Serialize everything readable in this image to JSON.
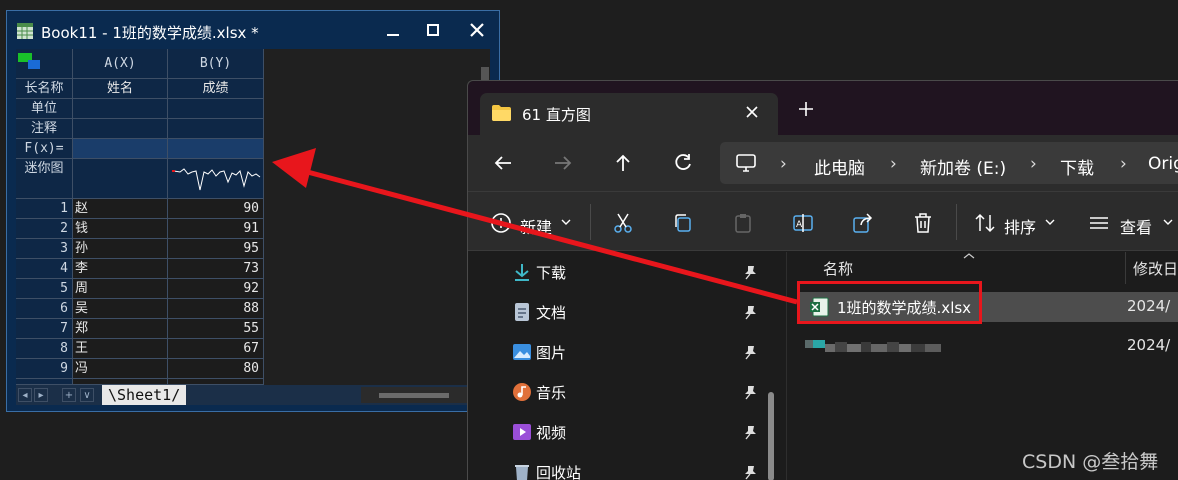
{
  "workbook": {
    "title": "Book11 - 1班的数学成绩.xlsx *",
    "columns": [
      {
        "header": "A(X)",
        "long_name": "姓名"
      },
      {
        "header": "B(Y)",
        "long_name": "成绩"
      }
    ],
    "row_labels": [
      "长名称",
      "单位",
      "注释",
      "F(x)=",
      "迷你图"
    ],
    "rows": [
      {
        "n": "1",
        "name": "赵",
        "score": "90"
      },
      {
        "n": "2",
        "name": "钱",
        "score": "91"
      },
      {
        "n": "3",
        "name": "孙",
        "score": "95"
      },
      {
        "n": "4",
        "name": "李",
        "score": "73"
      },
      {
        "n": "5",
        "name": "周",
        "score": "92"
      },
      {
        "n": "6",
        "name": "吴",
        "score": "88"
      },
      {
        "n": "7",
        "name": "郑",
        "score": "55"
      },
      {
        "n": "8",
        "name": "王",
        "score": "67"
      },
      {
        "n": "9",
        "name": "冯",
        "score": "80"
      }
    ],
    "sheet_tab": "\\Sheet1/",
    "nav_buttons": [
      "◂",
      "▸",
      "+",
      "∨"
    ]
  },
  "explorer": {
    "tab_title": "61 直方图",
    "breadcrumb": [
      "此电脑",
      "新加卷 (E:)",
      "下载",
      "Orig"
    ],
    "toolbar": {
      "new_label": "新建",
      "sort_label": "排序",
      "view_label": "查看"
    },
    "nav_items": [
      {
        "label": "下载",
        "icon": "download-icon",
        "color": "#3fb8c8"
      },
      {
        "label": "文档",
        "icon": "document-icon",
        "color": "#b9c6d6"
      },
      {
        "label": "图片",
        "icon": "pictures-icon",
        "color": "#3a8fe0"
      },
      {
        "label": "音乐",
        "icon": "music-icon",
        "color": "#e0703a"
      },
      {
        "label": "视频",
        "icon": "video-icon",
        "color": "#9a4ed8"
      },
      {
        "label": "回收站",
        "icon": "recycle-bin-icon",
        "color": "#9fb2c8"
      }
    ],
    "columns": {
      "name": "名称",
      "modified": "修改日"
    },
    "files": [
      {
        "name": "1班的数学成绩.xlsx",
        "date": "2024/",
        "selected": true
      },
      {
        "name": "",
        "date": "2024/",
        "selected": false
      }
    ]
  },
  "watermark": "CSDN @叁拾舞",
  "colors": {
    "highlight": "#e8161c",
    "selection": "#4d4d4d",
    "workbook_bg": "#0a2a4f"
  }
}
